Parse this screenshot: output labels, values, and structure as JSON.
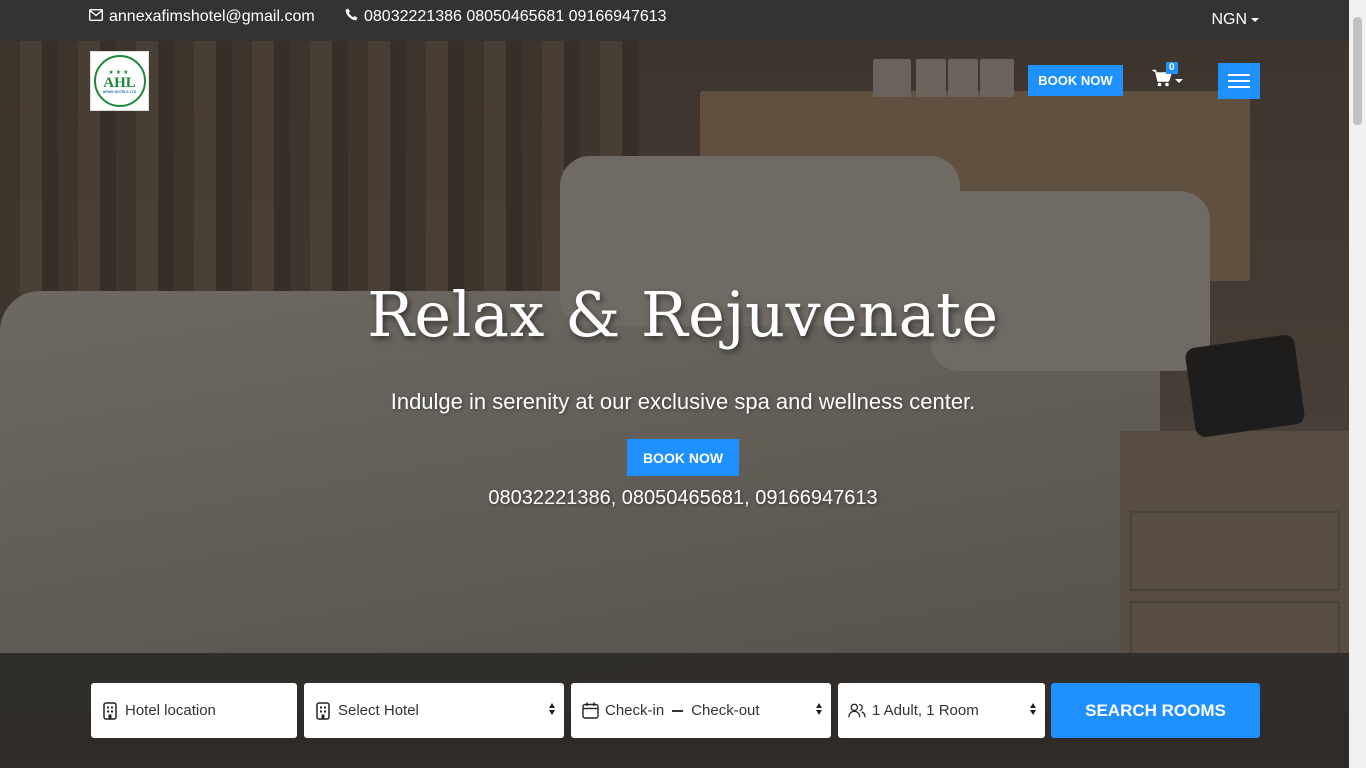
{
  "topbar": {
    "email": "annexafimshotel@gmail.com",
    "phones": "08032221386 08050465681 09166947613",
    "currency": "NGN"
  },
  "navbar": {
    "logo_mark": "AHL",
    "logo_sub": "AFIMS HOTELS LTD",
    "book_label": "BOOK NOW",
    "cart_count": "0"
  },
  "hero": {
    "headline": "Relax & Rejuvenate",
    "subline": "Indulge in serenity at our exclusive spa and wellness center.",
    "book_label": "BOOK NOW",
    "phones": "08032221386, 08050465681, 09166947613"
  },
  "search": {
    "location_placeholder": "Hotel location",
    "hotel_label": "Select Hotel",
    "checkin_label": "Check-in",
    "checkout_label": "Check-out",
    "guests_label": "1 Adult, 1 Room",
    "button_label": "SEARCH ROOMS"
  },
  "colors": {
    "accent": "#1e90ff",
    "topbar": "#333333"
  }
}
